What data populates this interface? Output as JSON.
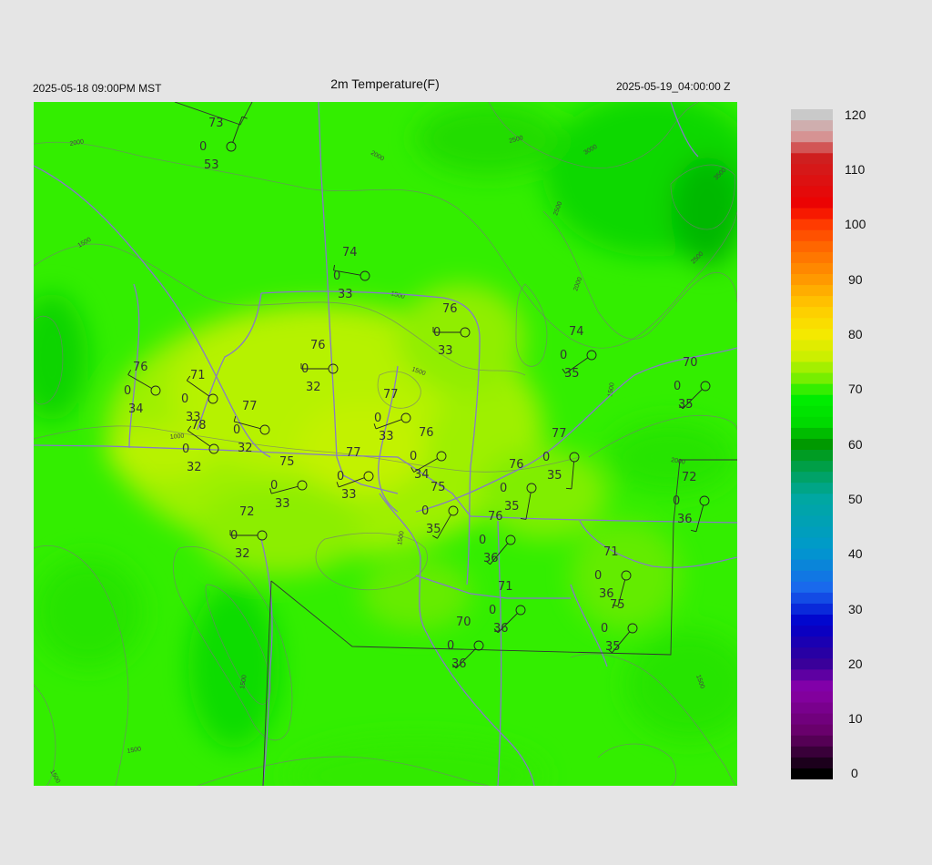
{
  "header": {
    "title": "2m Temperature(F)",
    "valid_local": "2025-05-18 09:00PM MST",
    "valid_utc": "2025-05-19_04:00:00 Z"
  },
  "colorbar": {
    "labels": [
      "120",
      "110",
      "100",
      "90",
      "80",
      "70",
      "60",
      "50",
      "40",
      "30",
      "20",
      "10",
      "0"
    ],
    "stops": [
      [
        0,
        "#c9c9c9"
      ],
      [
        0.04,
        "#d88888"
      ],
      [
        0.06,
        "#cc2222"
      ],
      [
        0.14,
        "#ee0000"
      ],
      [
        0.16,
        "#ff3300"
      ],
      [
        0.2,
        "#ff6600"
      ],
      [
        0.25,
        "#ff9900"
      ],
      [
        0.29,
        "#ffc800"
      ],
      [
        0.33,
        "#f8e800"
      ],
      [
        0.37,
        "#c8f000"
      ],
      [
        0.4,
        "#77ee00"
      ],
      [
        0.43,
        "#00ee00"
      ],
      [
        0.47,
        "#00d800"
      ],
      [
        0.5,
        "#009900"
      ],
      [
        0.54,
        "#00a055"
      ],
      [
        0.58,
        "#00a8a0"
      ],
      [
        0.66,
        "#0099cc"
      ],
      [
        0.72,
        "#1a66ee"
      ],
      [
        0.77,
        "#0000cc"
      ],
      [
        0.83,
        "#330099"
      ],
      [
        0.87,
        "#8800aa"
      ],
      [
        0.94,
        "#660066"
      ],
      [
        1,
        "#000000"
      ]
    ]
  },
  "contours": [
    {
      "label": "2000"
    },
    {
      "label": "2000"
    },
    {
      "label": "2500"
    },
    {
      "label": "3000"
    },
    {
      "label": "2500"
    },
    {
      "label": "3500"
    },
    {
      "label": "2500"
    },
    {
      "label": "2000"
    },
    {
      "label": "1500"
    },
    {
      "label": "1500"
    },
    {
      "label": "1500"
    },
    {
      "label": "1000"
    },
    {
      "label": "1500"
    },
    {
      "label": "2000"
    },
    {
      "label": "1500"
    },
    {
      "label": "1500"
    },
    {
      "label": "1500"
    },
    {
      "label": "1500"
    },
    {
      "label": "1500"
    }
  ],
  "stations": [
    {
      "temp": "73",
      "dew": "53",
      "cloud": "0",
      "dir": 20
    },
    {
      "temp": "74",
      "dew": "33",
      "cloud": "0",
      "dir": 280
    },
    {
      "temp": "76",
      "dew": "33",
      "cloud": "0",
      "dir": 270
    },
    {
      "temp": "74",
      "dew": "35",
      "cloud": "0",
      "dir": 235
    },
    {
      "temp": "76",
      "dew": "32",
      "cloud": "0",
      "dir": 270
    },
    {
      "temp": "76",
      "dew": "34",
      "cloud": "0",
      "dir": 300
    },
    {
      "temp": "71",
      "dew": "33",
      "cloud": "0",
      "dir": 305
    },
    {
      "temp": "70",
      "dew": "35",
      "cloud": "0",
      "dir": 225
    },
    {
      "temp": "77",
      "dew": "32",
      "cloud": "0",
      "dir": 285
    },
    {
      "temp": "77",
      "dew": "33",
      "cloud": "0",
      "dir": 250
    },
    {
      "temp": "78",
      "dew": "32",
      "cloud": "0",
      "dir": 305
    },
    {
      "temp": "76",
      "dew": "34",
      "cloud": "0",
      "dir": 240
    },
    {
      "temp": "77",
      "dew": "35",
      "cloud": "0",
      "dir": 185
    },
    {
      "temp": "77",
      "dew": "33",
      "cloud": "0",
      "dir": 250
    },
    {
      "temp": "75",
      "dew": "33",
      "cloud": "0",
      "dir": 255
    },
    {
      "temp": "76",
      "dew": "35",
      "cloud": "0",
      "dir": 190
    },
    {
      "temp": "72",
      "dew": "36",
      "cloud": "0",
      "dir": 195
    },
    {
      "temp": "75",
      "dew": "35",
      "cloud": "0",
      "dir": 210
    },
    {
      "temp": "72",
      "dew": "32",
      "cloud": "0",
      "dir": 270
    },
    {
      "temp": "76",
      "dew": "36",
      "cloud": "0",
      "dir": 220
    },
    {
      "temp": "71",
      "dew": "36",
      "cloud": "0",
      "dir": 195
    },
    {
      "temp": "71",
      "dew": "36",
      "cloud": "0",
      "dir": 225
    },
    {
      "temp": "70",
      "dew": "36",
      "cloud": "0",
      "dir": 225
    },
    {
      "temp": "75",
      "dew": "35",
      "cloud": "0",
      "dir": 220
    }
  ]
}
